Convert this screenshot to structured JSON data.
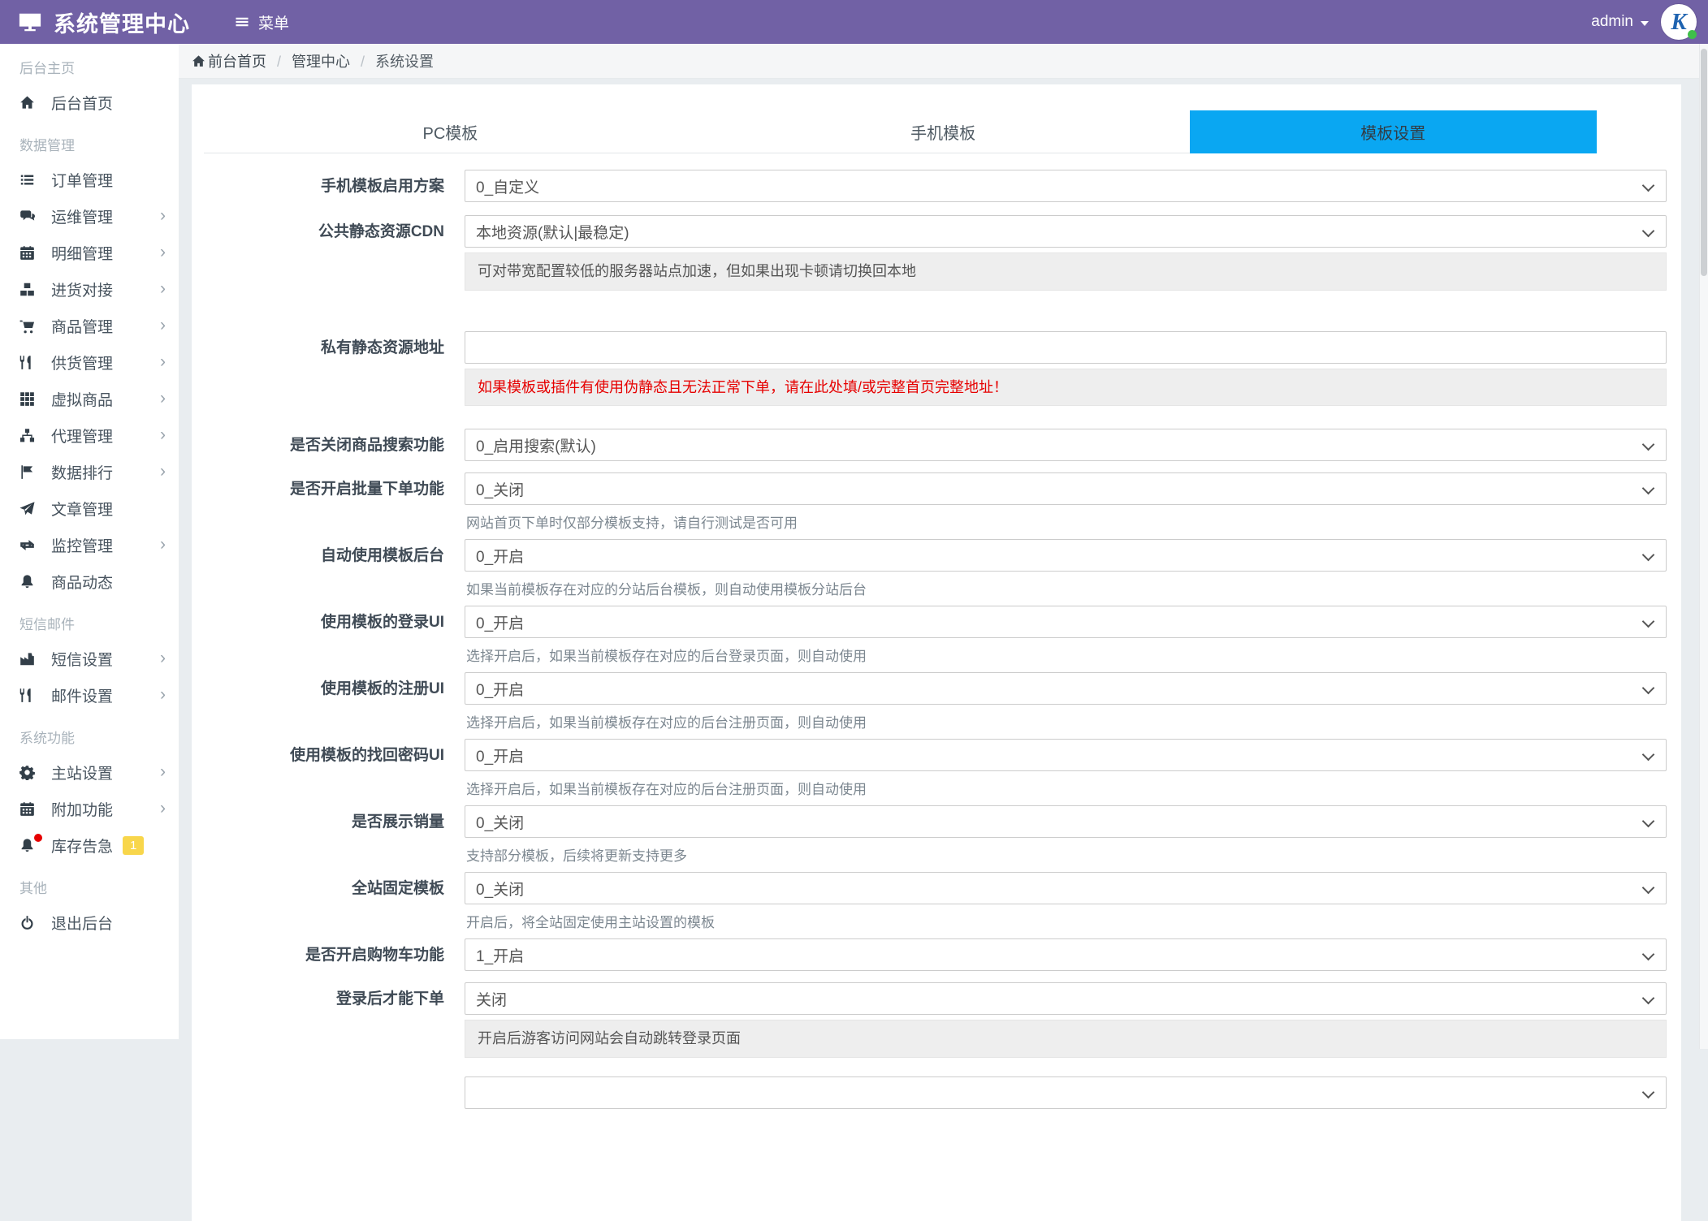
{
  "colors": {
    "navbar_purple": "#7161a5",
    "active_tab_blue": "#0aa7f2",
    "badge_yellow": "#f8d64b",
    "alert_red": "#e60000",
    "status_green": "#3fbf4a"
  },
  "header": {
    "brand": "系统管理中心",
    "brand_icon": "monitor-icon",
    "menu_label": "菜单",
    "user": "admin"
  },
  "breadcrumb": {
    "home": "前台首页",
    "items": [
      "管理中心",
      "系统设置"
    ]
  },
  "sidebar": {
    "sections": [
      {
        "label": "后台主页",
        "items": [
          {
            "label": "后台首页",
            "icon": "home-icon"
          }
        ]
      },
      {
        "label": "数据管理",
        "items": [
          {
            "label": "订单管理",
            "icon": "list-icon"
          },
          {
            "label": "运维管理",
            "icon": "comments-icon",
            "arrow": true
          },
          {
            "label": "明细管理",
            "icon": "calendar-icon",
            "arrow": true
          },
          {
            "label": "进货对接",
            "icon": "cubes-icon",
            "arrow": true
          },
          {
            "label": "商品管理",
            "icon": "cart-icon",
            "arrow": true
          },
          {
            "label": "供货管理",
            "icon": "cutlery-icon",
            "arrow": true
          },
          {
            "label": "虚拟商品",
            "icon": "grid-icon",
            "arrow": true
          },
          {
            "label": "代理管理",
            "icon": "sitemap-icon",
            "arrow": true
          },
          {
            "label": "数据排行",
            "icon": "flag-icon",
            "arrow": true
          },
          {
            "label": "文章管理",
            "icon": "paper-plane-icon"
          },
          {
            "label": "监控管理",
            "icon": "retweet-icon",
            "arrow": true
          },
          {
            "label": "商品动态",
            "icon": "bell-icon"
          }
        ]
      },
      {
        "label": "短信邮件",
        "items": [
          {
            "label": "短信设置",
            "icon": "factory-icon",
            "arrow": true
          },
          {
            "label": "邮件设置",
            "icon": "cutlery-icon",
            "arrow": true
          }
        ]
      },
      {
        "label": "系统功能",
        "items": [
          {
            "label": "主站设置",
            "icon": "gear-icon",
            "arrow": true
          },
          {
            "label": "附加功能",
            "icon": "calendar-icon",
            "arrow": true
          },
          {
            "label": "库存告急",
            "icon": "bell-icon",
            "alert_dot": true,
            "badge": "1"
          }
        ]
      },
      {
        "label": "其他",
        "items": [
          {
            "label": "退出后台",
            "icon": "power-icon"
          }
        ]
      }
    ]
  },
  "tabs": [
    {
      "label": "PC模板",
      "active": false
    },
    {
      "label": "手机模板",
      "active": false
    },
    {
      "label": "模板设置",
      "active": true
    }
  ],
  "form": {
    "rows": [
      {
        "label": "手机模板启用方案",
        "control": "select",
        "value": "0_自定义"
      },
      {
        "label": "公共静态资源CDN",
        "control": "select",
        "value": "本地资源(默认|最稳定)",
        "help": {
          "style": "box",
          "text": "可对带宽配置较低的服务器站点加速，但如果出现卡顿请切换回本地"
        }
      },
      {
        "label": "私有静态资源地址",
        "control": "input",
        "value": "",
        "help": {
          "style": "box-red",
          "text": "如果模板或插件有使用伪静态且无法正常下单，请在此处填/或完整首页完整地址！"
        }
      },
      {
        "label": "是否关闭商品搜索功能",
        "control": "select",
        "value": "0_启用搜索(默认)"
      },
      {
        "label": "是否开启批量下单功能",
        "control": "select",
        "value": "0_关闭",
        "help": {
          "style": "plain",
          "text": "网站首页下单时仅部分模板支持，请自行测试是否可用"
        }
      },
      {
        "label": "自动使用模板后台",
        "control": "select",
        "value": "0_开启",
        "help": {
          "style": "plain",
          "text": "如果当前模板存在对应的分站后台模板，则自动使用模板分站后台"
        }
      },
      {
        "label": "使用模板的登录UI",
        "control": "select",
        "value": "0_开启",
        "help": {
          "style": "plain",
          "text": "选择开启后，如果当前模板存在对应的后台登录页面，则自动使用"
        }
      },
      {
        "label": "使用模板的注册UI",
        "control": "select",
        "value": "0_开启",
        "help": {
          "style": "plain",
          "text": "选择开启后，如果当前模板存在对应的后台注册页面，则自动使用"
        }
      },
      {
        "label": "使用模板的找回密码UI",
        "control": "select",
        "value": "0_开启",
        "help": {
          "style": "plain",
          "text": "选择开启后，如果当前模板存在对应的后台注册页面，则自动使用"
        }
      },
      {
        "label": "是否展示销量",
        "control": "select",
        "value": "0_关闭",
        "help": {
          "style": "plain",
          "text": "支持部分模板，后续将更新支持更多"
        }
      },
      {
        "label": "全站固定模板",
        "control": "select",
        "value": "0_关闭",
        "help": {
          "style": "plain",
          "text": "开启后，将全站固定使用主站设置的模板"
        }
      },
      {
        "label": "是否开启购物车功能",
        "control": "select",
        "value": "1_开启"
      },
      {
        "label": "登录后才能下单",
        "control": "select",
        "value": "关闭",
        "help": {
          "style": "box",
          "text": "开启后游客访问网站会自动跳转登录页面"
        }
      },
      {
        "label": "",
        "control": "select",
        "value": ""
      }
    ]
  }
}
